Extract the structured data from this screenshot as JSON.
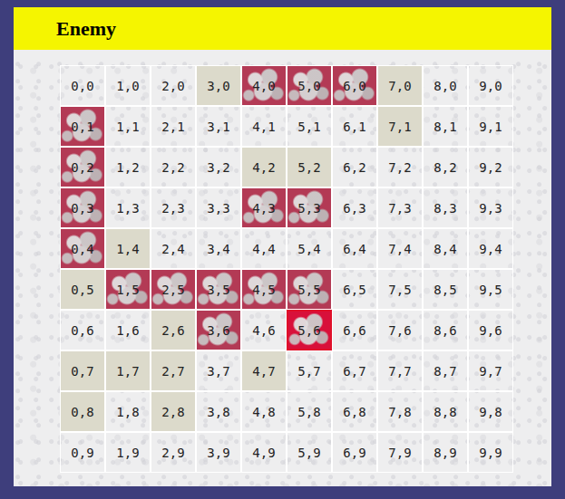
{
  "title": "Enemy",
  "grid": {
    "rows": [
      {
        "cells": [
          {
            "label": "0,0",
            "state": "empty",
            "selected": false
          },
          {
            "label": "1,0",
            "state": "empty",
            "selected": false
          },
          {
            "label": "2,0",
            "state": "empty",
            "selected": false
          },
          {
            "label": "3,0",
            "state": "miss",
            "selected": false
          },
          {
            "label": "4,0",
            "state": "hit",
            "selected": false
          },
          {
            "label": "5,0",
            "state": "hit",
            "selected": false
          },
          {
            "label": "6,0",
            "state": "hit",
            "selected": false
          },
          {
            "label": "7,0",
            "state": "miss",
            "selected": false
          },
          {
            "label": "8,0",
            "state": "empty",
            "selected": false
          },
          {
            "label": "9,0",
            "state": "empty",
            "selected": false
          }
        ]
      },
      {
        "cells": [
          {
            "label": "0,1",
            "state": "hit",
            "selected": false
          },
          {
            "label": "1,1",
            "state": "empty",
            "selected": false
          },
          {
            "label": "2,1",
            "state": "empty",
            "selected": false
          },
          {
            "label": "3,1",
            "state": "empty",
            "selected": false
          },
          {
            "label": "4,1",
            "state": "empty",
            "selected": false
          },
          {
            "label": "5,1",
            "state": "empty",
            "selected": false
          },
          {
            "label": "6,1",
            "state": "empty",
            "selected": false
          },
          {
            "label": "7,1",
            "state": "miss",
            "selected": false
          },
          {
            "label": "8,1",
            "state": "empty",
            "selected": false
          },
          {
            "label": "9,1",
            "state": "empty",
            "selected": false
          }
        ]
      },
      {
        "cells": [
          {
            "label": "0,2",
            "state": "hit",
            "selected": false
          },
          {
            "label": "1,2",
            "state": "empty",
            "selected": false
          },
          {
            "label": "2,2",
            "state": "empty",
            "selected": false
          },
          {
            "label": "3,2",
            "state": "empty",
            "selected": false
          },
          {
            "label": "4,2",
            "state": "miss",
            "selected": false
          },
          {
            "label": "5,2",
            "state": "miss",
            "selected": false
          },
          {
            "label": "6,2",
            "state": "empty",
            "selected": false
          },
          {
            "label": "7,2",
            "state": "empty",
            "selected": false
          },
          {
            "label": "8,2",
            "state": "empty",
            "selected": false
          },
          {
            "label": "9,2",
            "state": "empty",
            "selected": false
          }
        ]
      },
      {
        "cells": [
          {
            "label": "0,3",
            "state": "hit",
            "selected": false
          },
          {
            "label": "1,3",
            "state": "empty",
            "selected": false
          },
          {
            "label": "2,3",
            "state": "empty",
            "selected": false
          },
          {
            "label": "3,3",
            "state": "empty",
            "selected": false
          },
          {
            "label": "4,3",
            "state": "hit",
            "selected": false
          },
          {
            "label": "5,3",
            "state": "hit",
            "selected": false
          },
          {
            "label": "6,3",
            "state": "empty",
            "selected": false
          },
          {
            "label": "7,3",
            "state": "empty",
            "selected": false
          },
          {
            "label": "8,3",
            "state": "empty",
            "selected": false
          },
          {
            "label": "9,3",
            "state": "empty",
            "selected": false
          }
        ]
      },
      {
        "cells": [
          {
            "label": "0,4",
            "state": "hit",
            "selected": false
          },
          {
            "label": "1,4",
            "state": "miss",
            "selected": false
          },
          {
            "label": "2,4",
            "state": "empty",
            "selected": false
          },
          {
            "label": "3,4",
            "state": "empty",
            "selected": false
          },
          {
            "label": "4,4",
            "state": "empty",
            "selected": false
          },
          {
            "label": "5,4",
            "state": "empty",
            "selected": false
          },
          {
            "label": "6,4",
            "state": "empty",
            "selected": false
          },
          {
            "label": "7,4",
            "state": "empty",
            "selected": false
          },
          {
            "label": "8,4",
            "state": "empty",
            "selected": false
          },
          {
            "label": "9,4",
            "state": "empty",
            "selected": false
          }
        ]
      },
      {
        "cells": [
          {
            "label": "0,5",
            "state": "miss",
            "selected": false
          },
          {
            "label": "1,5",
            "state": "hit",
            "selected": false
          },
          {
            "label": "2,5",
            "state": "hit",
            "selected": false
          },
          {
            "label": "3,5",
            "state": "hit",
            "selected": false
          },
          {
            "label": "4,5",
            "state": "hit",
            "selected": false
          },
          {
            "label": "5,5",
            "state": "hit",
            "selected": false
          },
          {
            "label": "6,5",
            "state": "empty",
            "selected": false
          },
          {
            "label": "7,5",
            "state": "empty",
            "selected": false
          },
          {
            "label": "8,5",
            "state": "empty",
            "selected": false
          },
          {
            "label": "9,5",
            "state": "empty",
            "selected": false
          }
        ]
      },
      {
        "cells": [
          {
            "label": "0,6",
            "state": "empty",
            "selected": false
          },
          {
            "label": "1,6",
            "state": "empty",
            "selected": false
          },
          {
            "label": "2,6",
            "state": "miss",
            "selected": false
          },
          {
            "label": "3,6",
            "state": "hit",
            "selected": false
          },
          {
            "label": "4,6",
            "state": "empty",
            "selected": false
          },
          {
            "label": "5,6",
            "state": "hit",
            "selected": true
          },
          {
            "label": "6,6",
            "state": "empty",
            "selected": false
          },
          {
            "label": "7,6",
            "state": "empty",
            "selected": false
          },
          {
            "label": "8,6",
            "state": "empty",
            "selected": false
          },
          {
            "label": "9,6",
            "state": "empty",
            "selected": false
          }
        ]
      },
      {
        "cells": [
          {
            "label": "0,7",
            "state": "miss",
            "selected": false
          },
          {
            "label": "1,7",
            "state": "miss",
            "selected": false
          },
          {
            "label": "2,7",
            "state": "miss",
            "selected": false
          },
          {
            "label": "3,7",
            "state": "empty",
            "selected": false
          },
          {
            "label": "4,7",
            "state": "miss",
            "selected": false
          },
          {
            "label": "5,7",
            "state": "empty",
            "selected": false
          },
          {
            "label": "6,7",
            "state": "empty",
            "selected": false
          },
          {
            "label": "7,7",
            "state": "empty",
            "selected": false
          },
          {
            "label": "8,7",
            "state": "empty",
            "selected": false
          },
          {
            "label": "9,7",
            "state": "empty",
            "selected": false
          }
        ]
      },
      {
        "cells": [
          {
            "label": "0,8",
            "state": "miss",
            "selected": false
          },
          {
            "label": "1,8",
            "state": "empty",
            "selected": false
          },
          {
            "label": "2,8",
            "state": "miss",
            "selected": false
          },
          {
            "label": "3,8",
            "state": "empty",
            "selected": false
          },
          {
            "label": "4,8",
            "state": "empty",
            "selected": false
          },
          {
            "label": "5,8",
            "state": "empty",
            "selected": false
          },
          {
            "label": "6,8",
            "state": "empty",
            "selected": false
          },
          {
            "label": "7,8",
            "state": "empty",
            "selected": false
          },
          {
            "label": "8,8",
            "state": "empty",
            "selected": false
          },
          {
            "label": "9,8",
            "state": "empty",
            "selected": false
          }
        ]
      },
      {
        "cells": [
          {
            "label": "0,9",
            "state": "empty",
            "selected": false
          },
          {
            "label": "1,9",
            "state": "empty",
            "selected": false
          },
          {
            "label": "2,9",
            "state": "empty",
            "selected": false
          },
          {
            "label": "3,9",
            "state": "empty",
            "selected": false
          },
          {
            "label": "4,9",
            "state": "empty",
            "selected": false
          },
          {
            "label": "5,9",
            "state": "empty",
            "selected": false
          },
          {
            "label": "6,9",
            "state": "empty",
            "selected": false
          },
          {
            "label": "7,9",
            "state": "empty",
            "selected": false
          },
          {
            "label": "8,9",
            "state": "empty",
            "selected": false
          },
          {
            "label": "9,9",
            "state": "empty",
            "selected": false
          }
        ]
      }
    ]
  }
}
